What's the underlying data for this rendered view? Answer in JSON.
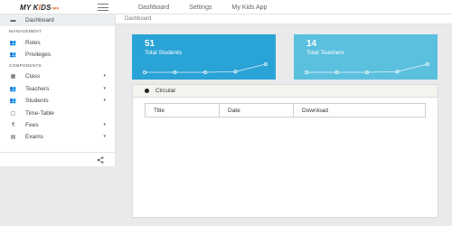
{
  "brand": {
    "logo_main": "MY K",
    "logo_accent": "I",
    "logo_tail": "DS",
    "logo_tag": "app"
  },
  "topnav": [
    "Dashboard",
    "Settings",
    "My Kids App"
  ],
  "sidebar": {
    "items": [
      {
        "label": "Dashboard",
        "icon": "dashboard-icon",
        "active": true
      },
      {
        "section": "MANAGEMENT"
      },
      {
        "label": "Roles",
        "icon": "users-icon"
      },
      {
        "label": "Privileges",
        "icon": "users-icon"
      },
      {
        "section": "COMPONENTS"
      },
      {
        "label": "Class",
        "icon": "class-icon",
        "caret": true
      },
      {
        "label": "Teachers",
        "icon": "teachers-icon",
        "caret": true
      },
      {
        "label": "Students",
        "icon": "students-icon",
        "caret": true
      },
      {
        "label": "Time-Table",
        "icon": "calendar-icon"
      },
      {
        "label": "Fees",
        "icon": "rupee-icon",
        "caret": true
      },
      {
        "label": "Exams",
        "icon": "exams-icon",
        "caret": true
      }
    ],
    "caret_glyph": "▾"
  },
  "breadcrumb": "Dashboard",
  "cards": [
    {
      "value": "51",
      "label": "Total Students",
      "color": "#2aa3d6",
      "sparkline": [
        0,
        0,
        0,
        0.05,
        0.6
      ]
    },
    {
      "value": "14",
      "label": "Total Teachers",
      "color": "#5bc0de",
      "sparkline": [
        0,
        0,
        0,
        0.05,
        0.6
      ]
    }
  ],
  "circular": {
    "title": "Circular",
    "columns": [
      "Title",
      "Date",
      "Download"
    ]
  }
}
